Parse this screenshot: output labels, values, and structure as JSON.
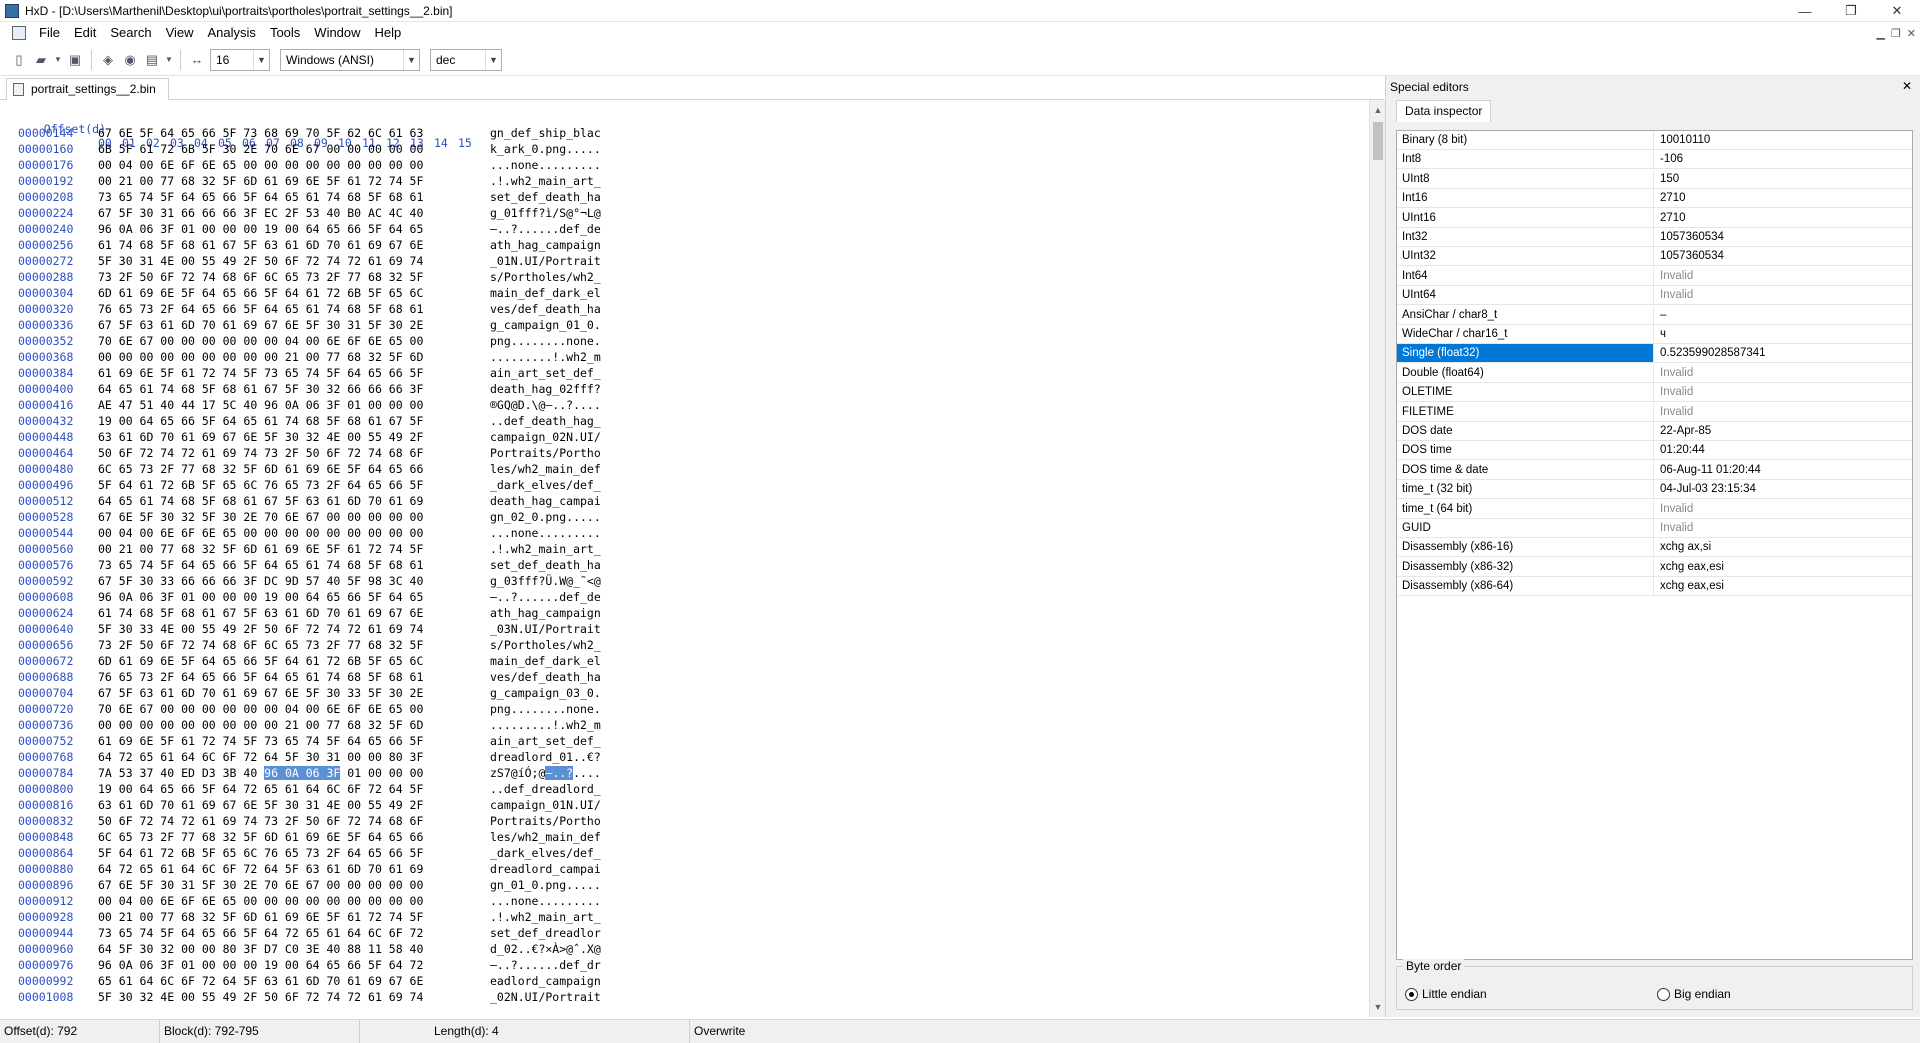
{
  "window": {
    "app": "HxD",
    "title": "HxD - [D:\\Users\\Marthenil\\Desktop\\ui\\portraits\\portholes\\portrait_settings__2.bin]",
    "minimize": "—",
    "maximize": "❐",
    "close": "✕"
  },
  "menu": [
    "File",
    "Edit",
    "Search",
    "View",
    "Analysis",
    "Tools",
    "Window",
    "Help"
  ],
  "toolbar": {
    "bytes_per_row": "16",
    "charset": "Windows (ANSI)",
    "offset_base": "dec"
  },
  "tab": {
    "label": "portrait_settings__2.bin"
  },
  "hex_view": {
    "header_label": "Offset(d)",
    "columns": [
      "00",
      "01",
      "02",
      "03",
      "04",
      "05",
      "06",
      "07",
      "08",
      "09",
      "10",
      "11",
      "12",
      "13",
      "14",
      "15"
    ],
    "rows": [
      {
        "off": "00000144",
        "hex": "67 6E 5F 64 65 66 5F 73 68 69 70 5F 62 6C 61 63",
        "asc": "gn_def_ship_blac"
      },
      {
        "off": "00000160",
        "hex": "6B 5F 61 72 6B 5F 30 2E 70 6E 67 00 00 00 00 00",
        "asc": "k_ark_0.png....."
      },
      {
        "off": "00000176",
        "hex": "00 04 00 6E 6F 6E 65 00 00 00 00 00 00 00 00 00",
        "asc": "...none........."
      },
      {
        "off": "00000192",
        "hex": "00 21 00 77 68 32 5F 6D 61 69 6E 5F 61 72 74 5F",
        "asc": ".!.wh2_main_art_"
      },
      {
        "off": "00000208",
        "hex": "73 65 74 5F 64 65 66 5F 64 65 61 74 68 5F 68 61",
        "asc": "set_def_death_ha"
      },
      {
        "off": "00000224",
        "hex": "67 5F 30 31 66 66 66 3F EC 2F 53 40 B0 AC 4C 40",
        "asc": "g_01fff?ì/S@°¬L@"
      },
      {
        "off": "00000240",
        "hex": "96 0A 06 3F 01 00 00 00 19 00 64 65 66 5F 64 65",
        "asc": "–..?......def_de"
      },
      {
        "off": "00000256",
        "hex": "61 74 68 5F 68 61 67 5F 63 61 6D 70 61 69 67 6E",
        "asc": "ath_hag_campaign"
      },
      {
        "off": "00000272",
        "hex": "5F 30 31 4E 00 55 49 2F 50 6F 72 74 72 61 69 74",
        "asc": "_01N.UI/Portrait"
      },
      {
        "off": "00000288",
        "hex": "73 2F 50 6F 72 74 68 6F 6C 65 73 2F 77 68 32 5F",
        "asc": "s/Portholes/wh2_"
      },
      {
        "off": "00000304",
        "hex": "6D 61 69 6E 5F 64 65 66 5F 64 61 72 6B 5F 65 6C",
        "asc": "main_def_dark_el"
      },
      {
        "off": "00000320",
        "hex": "76 65 73 2F 64 65 66 5F 64 65 61 74 68 5F 68 61",
        "asc": "ves/def_death_ha"
      },
      {
        "off": "00000336",
        "hex": "67 5F 63 61 6D 70 61 69 67 6E 5F 30 31 5F 30 2E",
        "asc": "g_campaign_01_0."
      },
      {
        "off": "00000352",
        "hex": "70 6E 67 00 00 00 00 00 00 04 00 6E 6F 6E 65 00",
        "asc": "png........none."
      },
      {
        "off": "00000368",
        "hex": "00 00 00 00 00 00 00 00 00 21 00 77 68 32 5F 6D",
        "asc": ".........!.wh2_m"
      },
      {
        "off": "00000384",
        "hex": "61 69 6E 5F 61 72 74 5F 73 65 74 5F 64 65 66 5F",
        "asc": "ain_art_set_def_"
      },
      {
        "off": "00000400",
        "hex": "64 65 61 74 68 5F 68 61 67 5F 30 32 66 66 66 3F",
        "asc": "death_hag_02fff?"
      },
      {
        "off": "00000416",
        "hex": "AE 47 51 40 44 17 5C 40 96 0A 06 3F 01 00 00 00",
        "asc": "®GQ@D.\\@–..?...."
      },
      {
        "off": "00000432",
        "hex": "19 00 64 65 66 5F 64 65 61 74 68 5F 68 61 67 5F",
        "asc": "..def_death_hag_"
      },
      {
        "off": "00000448",
        "hex": "63 61 6D 70 61 69 67 6E 5F 30 32 4E 00 55 49 2F",
        "asc": "campaign_02N.UI/"
      },
      {
        "off": "00000464",
        "hex": "50 6F 72 74 72 61 69 74 73 2F 50 6F 72 74 68 6F",
        "asc": "Portraits/Portho"
      },
      {
        "off": "00000480",
        "hex": "6C 65 73 2F 77 68 32 5F 6D 61 69 6E 5F 64 65 66",
        "asc": "les/wh2_main_def"
      },
      {
        "off": "00000496",
        "hex": "5F 64 61 72 6B 5F 65 6C 76 65 73 2F 64 65 66 5F",
        "asc": "_dark_elves/def_"
      },
      {
        "off": "00000512",
        "hex": "64 65 61 74 68 5F 68 61 67 5F 63 61 6D 70 61 69",
        "asc": "death_hag_campai"
      },
      {
        "off": "00000528",
        "hex": "67 6E 5F 30 32 5F 30 2E 70 6E 67 00 00 00 00 00",
        "asc": "gn_02_0.png....."
      },
      {
        "off": "00000544",
        "hex": "00 04 00 6E 6F 6E 65 00 00 00 00 00 00 00 00 00",
        "asc": "...none........."
      },
      {
        "off": "00000560",
        "hex": "00 21 00 77 68 32 5F 6D 61 69 6E 5F 61 72 74 5F",
        "asc": ".!.wh2_main_art_"
      },
      {
        "off": "00000576",
        "hex": "73 65 74 5F 64 65 66 5F 64 65 61 74 68 5F 68 61",
        "asc": "set_def_death_ha"
      },
      {
        "off": "00000592",
        "hex": "67 5F 30 33 66 66 66 3F DC 9D 57 40 5F 98 3C 40",
        "asc": "g_03fff?Ü.W@_˜<@"
      },
      {
        "off": "00000608",
        "hex": "96 0A 06 3F 01 00 00 00 19 00 64 65 66 5F 64 65",
        "asc": "–..?......def_de"
      },
      {
        "off": "00000624",
        "hex": "61 74 68 5F 68 61 67 5F 63 61 6D 70 61 69 67 6E",
        "asc": "ath_hag_campaign"
      },
      {
        "off": "00000640",
        "hex": "5F 30 33 4E 00 55 49 2F 50 6F 72 74 72 61 69 74",
        "asc": "_03N.UI/Portrait"
      },
      {
        "off": "00000656",
        "hex": "73 2F 50 6F 72 74 68 6F 6C 65 73 2F 77 68 32 5F",
        "asc": "s/Portholes/wh2_"
      },
      {
        "off": "00000672",
        "hex": "6D 61 69 6E 5F 64 65 66 5F 64 61 72 6B 5F 65 6C",
        "asc": "main_def_dark_el"
      },
      {
        "off": "00000688",
        "hex": "76 65 73 2F 64 65 66 5F 64 65 61 74 68 5F 68 61",
        "asc": "ves/def_death_ha"
      },
      {
        "off": "00000704",
        "hex": "67 5F 63 61 6D 70 61 69 67 6E 5F 30 33 5F 30 2E",
        "asc": "g_campaign_03_0."
      },
      {
        "off": "00000720",
        "hex": "70 6E 67 00 00 00 00 00 00 04 00 6E 6F 6E 65 00",
        "asc": "png........none."
      },
      {
        "off": "00000736",
        "hex": "00 00 00 00 00 00 00 00 00 21 00 77 68 32 5F 6D",
        "asc": ".........!.wh2_m"
      },
      {
        "off": "00000752",
        "hex": "61 69 6E 5F 61 72 74 5F 73 65 74 5F 64 65 66 5F",
        "asc": "ain_art_set_def_"
      },
      {
        "off": "00000768",
        "hex": "64 72 65 61 64 6C 6F 72 64 5F 30 31 00 00 80 3F",
        "asc": "dreadlord_01..€?"
      },
      {
        "off": "00000784",
        "hex_pre": "7A 53 37 40 ED D3 3B 40 ",
        "hex_sel": "96 0A 06 3F",
        "hex_post": " 01 00 00 00",
        "asc_pre": "zS7@íÓ;@",
        "asc_sel": "–..?",
        "asc_post": "....",
        "highlight": true
      },
      {
        "off": "00000800",
        "hex": "19 00 64 65 66 5F 64 72 65 61 64 6C 6F 72 64 5F",
        "asc": "..def_dreadlord_"
      },
      {
        "off": "00000816",
        "hex": "63 61 6D 70 61 69 67 6E 5F 30 31 4E 00 55 49 2F",
        "asc": "campaign_01N.UI/"
      },
      {
        "off": "00000832",
        "hex": "50 6F 72 74 72 61 69 74 73 2F 50 6F 72 74 68 6F",
        "asc": "Portraits/Portho"
      },
      {
        "off": "00000848",
        "hex": "6C 65 73 2F 77 68 32 5F 6D 61 69 6E 5F 64 65 66",
        "asc": "les/wh2_main_def"
      },
      {
        "off": "00000864",
        "hex": "5F 64 61 72 6B 5F 65 6C 76 65 73 2F 64 65 66 5F",
        "asc": "_dark_elves/def_"
      },
      {
        "off": "00000880",
        "hex": "64 72 65 61 64 6C 6F 72 64 5F 63 61 6D 70 61 69",
        "asc": "dreadlord_campai"
      },
      {
        "off": "00000896",
        "hex": "67 6E 5F 30 31 5F 30 2E 70 6E 67 00 00 00 00 00",
        "asc": "gn_01_0.png....."
      },
      {
        "off": "00000912",
        "hex": "00 04 00 6E 6F 6E 65 00 00 00 00 00 00 00 00 00",
        "asc": "...none........."
      },
      {
        "off": "00000928",
        "hex": "00 21 00 77 68 32 5F 6D 61 69 6E 5F 61 72 74 5F",
        "asc": ".!.wh2_main_art_"
      },
      {
        "off": "00000944",
        "hex": "73 65 74 5F 64 65 66 5F 64 72 65 61 64 6C 6F 72",
        "asc": "set_def_dreadlor"
      },
      {
        "off": "00000960",
        "hex": "64 5F 30 32 00 00 80 3F D7 C0 3E 40 88 11 58 40",
        "asc": "d_02..€?×À>@ˆ.X@"
      },
      {
        "off": "00000976",
        "hex": "96 0A 06 3F 01 00 00 00 19 00 64 65 66 5F 64 72",
        "asc": "–..?......def_dr"
      },
      {
        "off": "00000992",
        "hex": "65 61 64 6C 6F 72 64 5F 63 61 6D 70 61 69 67 6E",
        "asc": "eadlord_campaign"
      },
      {
        "off": "00001008",
        "hex": "5F 30 32 4E 00 55 49 2F 50 6F 72 74 72 61 69 74",
        "asc": "_02N.UI/Portrait"
      }
    ]
  },
  "side_panel": {
    "title": "Special editors",
    "close": "✕",
    "tab": "Data inspector",
    "rows": [
      {
        "k": "Binary (8 bit)",
        "v": "10010110"
      },
      {
        "k": "Int8",
        "v": "-106"
      },
      {
        "k": "UInt8",
        "v": "150"
      },
      {
        "k": "Int16",
        "v": "2710"
      },
      {
        "k": "UInt16",
        "v": "2710"
      },
      {
        "k": "Int32",
        "v": "1057360534"
      },
      {
        "k": "UInt32",
        "v": "1057360534"
      },
      {
        "k": "Int64",
        "v": "Invalid",
        "invalid": true
      },
      {
        "k": "UInt64",
        "v": "Invalid",
        "invalid": true
      },
      {
        "k": "AnsiChar / char8_t",
        "v": "–"
      },
      {
        "k": "WideChar / char16_t",
        "v": "ч"
      },
      {
        "k": "Single (float32)",
        "v": "0.523599028587341",
        "selected": true
      },
      {
        "k": "Double (float64)",
        "v": "Invalid",
        "invalid": true
      },
      {
        "k": "OLETIME",
        "v": "Invalid",
        "invalid": true
      },
      {
        "k": "FILETIME",
        "v": "Invalid",
        "invalid": true
      },
      {
        "k": "DOS date",
        "v": "22-Apr-85"
      },
      {
        "k": "DOS time",
        "v": "01:20:44"
      },
      {
        "k": "DOS time & date",
        "v": "06-Aug-11 01:20:44"
      },
      {
        "k": "time_t (32 bit)",
        "v": "04-Jul-03 23:15:34"
      },
      {
        "k": "time_t (64 bit)",
        "v": "Invalid",
        "invalid": true
      },
      {
        "k": "GUID",
        "v": "Invalid",
        "invalid": true
      },
      {
        "k": "Disassembly (x86-16)",
        "v": "xchg ax,si"
      },
      {
        "k": "Disassembly (x86-32)",
        "v": "xchg eax,esi"
      },
      {
        "k": "Disassembly (x86-64)",
        "v": "xchg eax,esi"
      }
    ],
    "byte_order": {
      "legend": "Byte order",
      "little": "Little endian",
      "big": "Big endian",
      "selected": "little"
    }
  },
  "status": {
    "offset": "Offset(d): 792",
    "block": "Block(d): 792-795",
    "length": "Length(d): 4",
    "mode": "Overwrite"
  },
  "colors": {
    "offset_blue": "#2b4fc5",
    "selection": "#0078d7",
    "hex_highlight": "#5b8fd6"
  }
}
